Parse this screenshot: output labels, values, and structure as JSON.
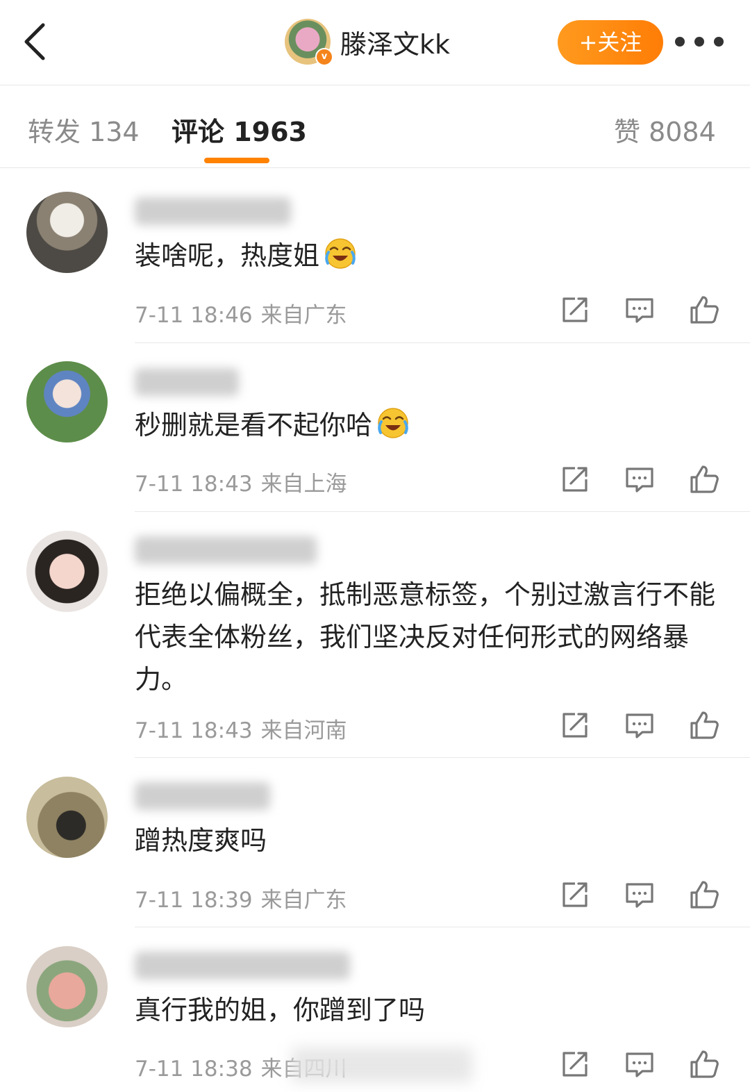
{
  "header": {
    "account_name": "滕泽文kk",
    "follow_label": "+关注",
    "back_icon": "chevron-left-icon",
    "more_icon": "more-dots-icon",
    "verified_badge": "v"
  },
  "tabs": [
    {
      "label": "转发 134"
    },
    {
      "label": "评论 1963"
    },
    {
      "label": "赞 8084"
    }
  ],
  "colors": {
    "accent": "#ff8200",
    "meta": "#9a9a9a"
  },
  "comments": [
    {
      "text": "装啥呢，热度姐",
      "emoji": "laughing-crying-emoji",
      "time": "7-11 18:46",
      "location": "来自广东"
    },
    {
      "text": "秒删就是看不起你哈",
      "emoji": "laughing-crying-emoji",
      "time": "7-11 18:43",
      "location": "来自上海"
    },
    {
      "text": "拒绝以偏概全，抵制恶意标签，个别过激言行不能代表全体粉丝，我们坚决反对任何形式的网络暴力。",
      "time": "7-11 18:43",
      "location": "来自河南"
    },
    {
      "text": "蹭热度爽吗",
      "time": "7-11 18:39",
      "location": "来自广东"
    },
    {
      "text": "真行我的姐，你蹭到了吗",
      "time": "7-11 18:38",
      "location": "来自四川"
    }
  ]
}
